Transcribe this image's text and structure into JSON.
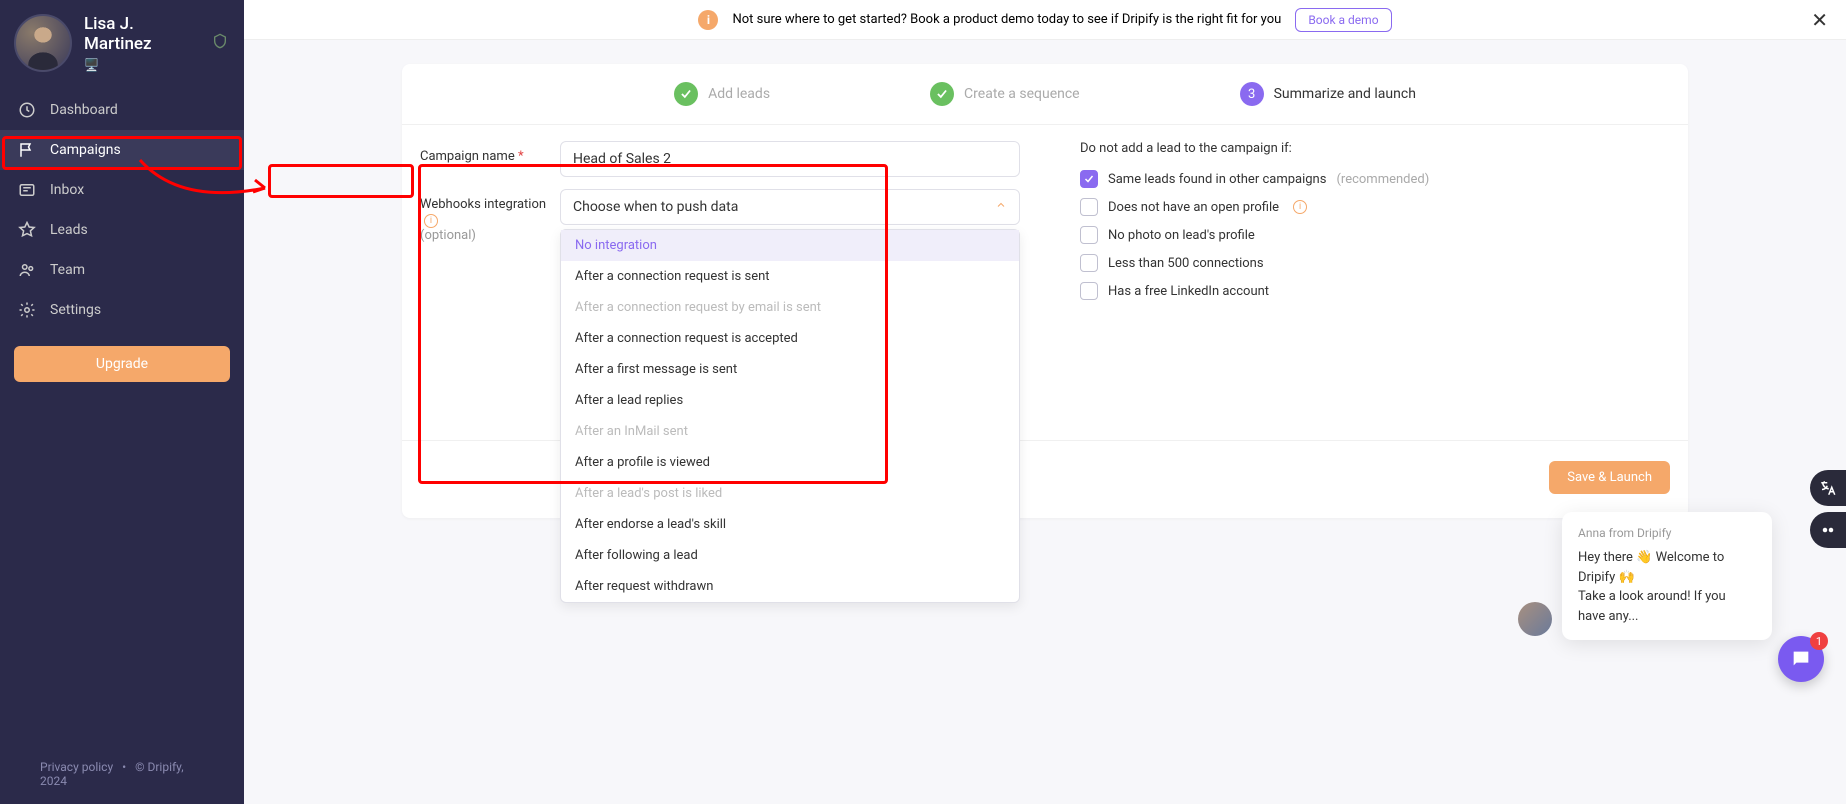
{
  "profile": {
    "name": "Lisa J. Martinez",
    "badge": "🖥️"
  },
  "nav": {
    "dashboard": "Dashboard",
    "campaigns": "Campaigns",
    "inbox": "Inbox",
    "leads": "Leads",
    "team": "Team",
    "settings": "Settings"
  },
  "upgrade": "Upgrade",
  "footer": {
    "privacy": "Privacy policy",
    "sep": "•",
    "copy": "© Dripify, 2024"
  },
  "banner": {
    "text": "Not sure where to get started? Book a product demo today to see if Dripify is the right fit for you",
    "cta": "Book a demo"
  },
  "steps": {
    "s1": "Add leads",
    "s2": "Create a sequence",
    "s3num": "3",
    "s3": "Summarize and launch"
  },
  "form": {
    "name_label": "Campaign name",
    "name_value": "Head of Sales 2",
    "webhook_label": "Webhooks integration",
    "webhook_optional": "(optional)"
  },
  "select": {
    "placeholder": "Choose when to push data",
    "options": [
      {
        "label": "No integration",
        "state": "selected"
      },
      {
        "label": "After a connection request is sent",
        "state": "enabled"
      },
      {
        "label": "After a connection request by email is sent",
        "state": "disabled"
      },
      {
        "label": "After a connection request is accepted",
        "state": "enabled"
      },
      {
        "label": "After a first message is sent",
        "state": "enabled"
      },
      {
        "label": "After a lead replies",
        "state": "enabled"
      },
      {
        "label": "After an InMail sent",
        "state": "disabled"
      },
      {
        "label": "After a profile is viewed",
        "state": "enabled"
      },
      {
        "label": "After a lead's post is liked",
        "state": "disabled"
      },
      {
        "label": "After endorse a lead's skill",
        "state": "enabled"
      },
      {
        "label": "After following a lead",
        "state": "enabled"
      },
      {
        "label": "After request withdrawn",
        "state": "enabled"
      }
    ]
  },
  "exclusions": {
    "title": "Do not add a lead to the campaign if:",
    "items": [
      {
        "label": "Same leads found in other campaigns",
        "rec": "(recommended)",
        "checked": true,
        "info": false
      },
      {
        "label": "Does not have an open profile",
        "rec": "",
        "checked": false,
        "info": true
      },
      {
        "label": "No photo on lead's profile",
        "rec": "",
        "checked": false,
        "info": false
      },
      {
        "label": "Less than 500 connections",
        "rec": "",
        "checked": false,
        "info": false
      },
      {
        "label": "Has a free LinkedIn account",
        "rec": "",
        "checked": false,
        "info": false
      }
    ]
  },
  "actions": {
    "save": "Save & Launch"
  },
  "chat": {
    "from": "Anna from Dripify",
    "line1": "Hey there 👋 Welcome to Dripify 🙌",
    "line2": "Take a look around! If you have any...",
    "badge": "1"
  }
}
